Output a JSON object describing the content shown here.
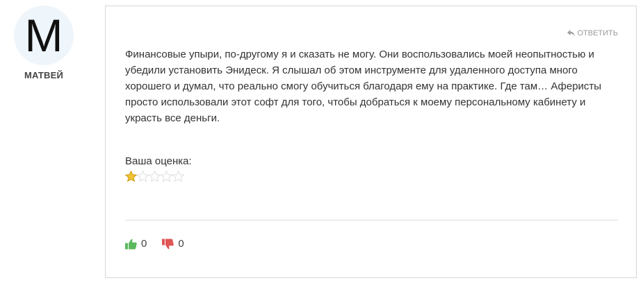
{
  "author": {
    "avatar_letter": "M",
    "name": "МАТВЕЙ"
  },
  "comment": {
    "reply_label": "ОТВЕТИТЬ",
    "text": "Финансовые упыри, по-другому я и сказать не могу. Они воспользовались моей неопытностью и убедили установить Энидеск. Я слышал об этом инструменте для удаленного доступа много хорошего и думал, что реально смогу обучиться благодаря ему на практике. Где там… Аферисты просто использовали этот софт для того, чтобы добраться к моему персональному кабинету и украсть все деньги.",
    "rating_label": "Ваша оценка:",
    "rating": 1,
    "rating_max": 5
  },
  "votes": {
    "likes": "0",
    "dislikes": "0"
  },
  "colors": {
    "like": "#5cb85c",
    "dislike": "#e05555",
    "star_filled": "#f2c230",
    "star_empty": "#dddddd"
  },
  "icons": {
    "reply": "reply-arrow-icon",
    "like": "thumbs-up-icon",
    "dislike": "thumbs-down-icon",
    "star": "star-icon"
  }
}
